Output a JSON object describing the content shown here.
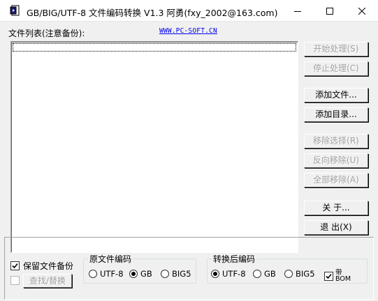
{
  "window": {
    "title": "GB/BIG/UTF-8 文件编码转换 V1.3  阿勇(fxy_2002@163.com)"
  },
  "file_list": {
    "label": "文件列表(注意备份):",
    "url": "WWW.PC-SOFT.CN"
  },
  "buttons": {
    "start": "开始处理(S)",
    "stop": "停止处理(C)",
    "add_file": "添加文件...",
    "add_dir": "添加目录...",
    "remove_selected": "移除选择(R)",
    "invert_remove": "反向移除(U)",
    "remove_all": "全部移除(A)",
    "about": "关  于...",
    "exit": "退  出(X)"
  },
  "options": {
    "backup_label": "保留文件备份",
    "backup_checked": true,
    "find_replace_label": "查找/替换",
    "find_replace_checked": false
  },
  "source_encoding": {
    "title": "原文件编码",
    "options": [
      "UTF-8",
      "GB",
      "BIG5"
    ],
    "selected": "GB"
  },
  "target_encoding": {
    "title": "转换后编码",
    "options": [
      "UTF-8",
      "GB",
      "BIG5"
    ],
    "selected": "UTF-8",
    "bom_label_line1": "带",
    "bom_label_line2": "BOM",
    "bom_checked": true
  },
  "colors": {
    "window_bg": "#f0f0f0",
    "link": "#0000ee",
    "disabled_text": "#a0a0a0"
  }
}
